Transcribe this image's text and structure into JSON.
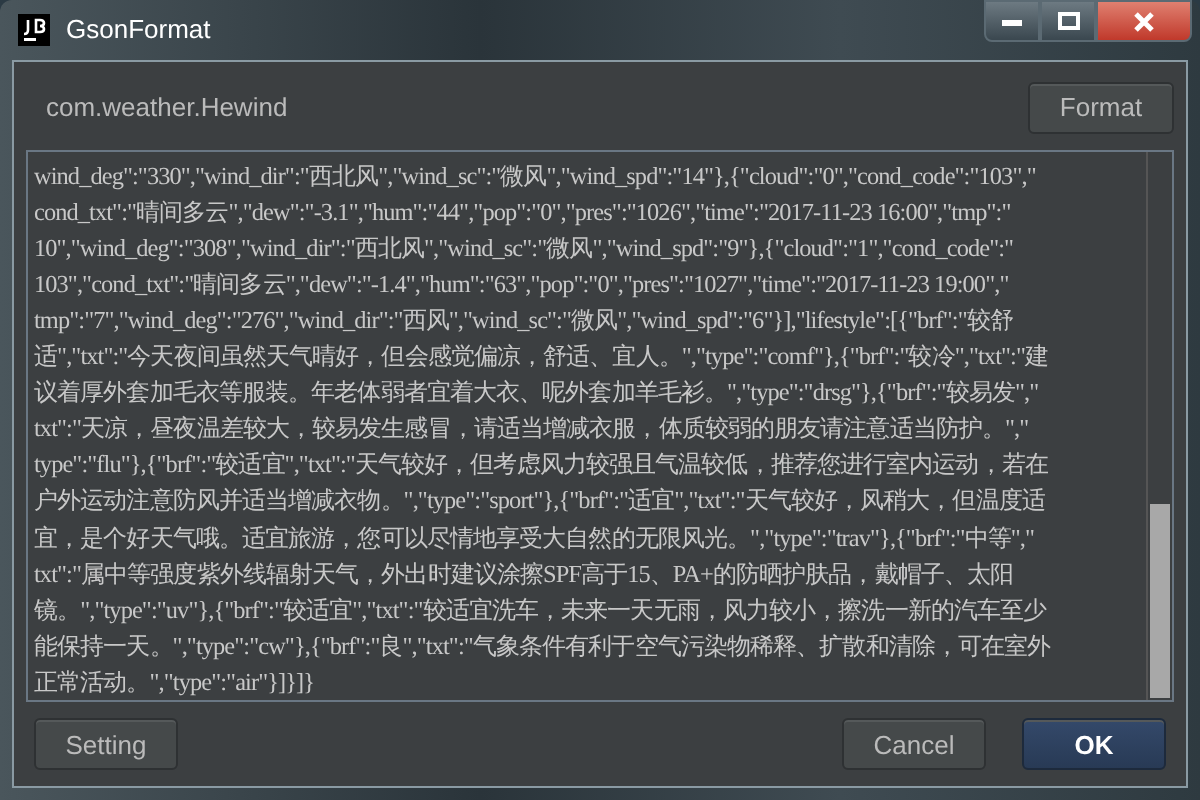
{
  "window": {
    "title": "GsonFormat"
  },
  "class_name": "com.weather.Hewind",
  "format_button": "Format",
  "json_lines": [
    "wind_deg\":\"330\",\"wind_dir\":\"西北风\",\"wind_sc\":\"微风\",\"wind_spd\":\"14\"},{\"cloud\":\"0\",\"cond_code\":\"103\",\"",
    "cond_txt\":\"晴间多云\",\"dew\":\"-3.1\",\"hum\":\"44\",\"pop\":\"0\",\"pres\":\"1026\",\"time\":\"2017-11-23 16:00\",\"tmp\":\"",
    "10\",\"wind_deg\":\"308\",\"wind_dir\":\"西北风\",\"wind_sc\":\"微风\",\"wind_spd\":\"9\"},{\"cloud\":\"1\",\"cond_code\":\"",
    "103\",\"cond_txt\":\"晴间多云\",\"dew\":\"-1.4\",\"hum\":\"63\",\"pop\":\"0\",\"pres\":\"1027\",\"time\":\"2017-11-23 19:00\",\"",
    "tmp\":\"7\",\"wind_deg\":\"276\",\"wind_dir\":\"西风\",\"wind_sc\":\"微风\",\"wind_spd\":\"6\"}],\"lifestyle\":[{\"brf\":\"较舒",
    "适\",\"txt\":\"今天夜间虽然天气晴好，但会感觉偏凉，舒适、宜人。\",\"type\":\"comf\"},{\"brf\":\"较冷\",\"txt\":\"建",
    "议着厚外套加毛衣等服装。年老体弱者宜着大衣、呢外套加羊毛衫。\",\"type\":\"drsg\"},{\"brf\":\"较易发\",\"",
    "txt\":\"天凉，昼夜温差较大，较易发生感冒，请适当增减衣服，体质较弱的朋友请注意适当防护。\",\"",
    "type\":\"flu\"},{\"brf\":\"较适宜\",\"txt\":\"天气较好，但考虑风力较强且气温较低，推荐您进行室内运动，若在",
    "户外运动注意防风并适当增减衣物。\",\"type\":\"sport\"},{\"brf\":\"适宜\",\"txt\":\"天气较好，风稍大，但温度适",
    "宜，是个好天气哦。适宜旅游，您可以尽情地享受大自然的无限风光。\",\"type\":\"trav\"},{\"brf\":\"中等\",\"",
    "txt\":\"属中等强度紫外线辐射天气，外出时建议涂擦SPF高于15、PA+的防晒护肤品，戴帽子、太阳",
    "镜。\",\"type\":\"uv\"},{\"brf\":\"较适宜\",\"txt\":\"较适宜洗车，未来一天无雨，风力较小，擦洗一新的汽车至少",
    "能保持一天。\",\"type\":\"cw\"},{\"brf\":\"良\",\"txt\":\"气象条件有利于空气污染物稀释、扩散和清除，可在室外",
    "正常活动。\",\"type\":\"air\"}]}]}"
  ],
  "buttons": [
    {
      "label": "Setting",
      "kind": "plain"
    },
    {
      "label": "Cancel",
      "kind": "plain"
    },
    {
      "label": "OK",
      "kind": "default"
    }
  ]
}
